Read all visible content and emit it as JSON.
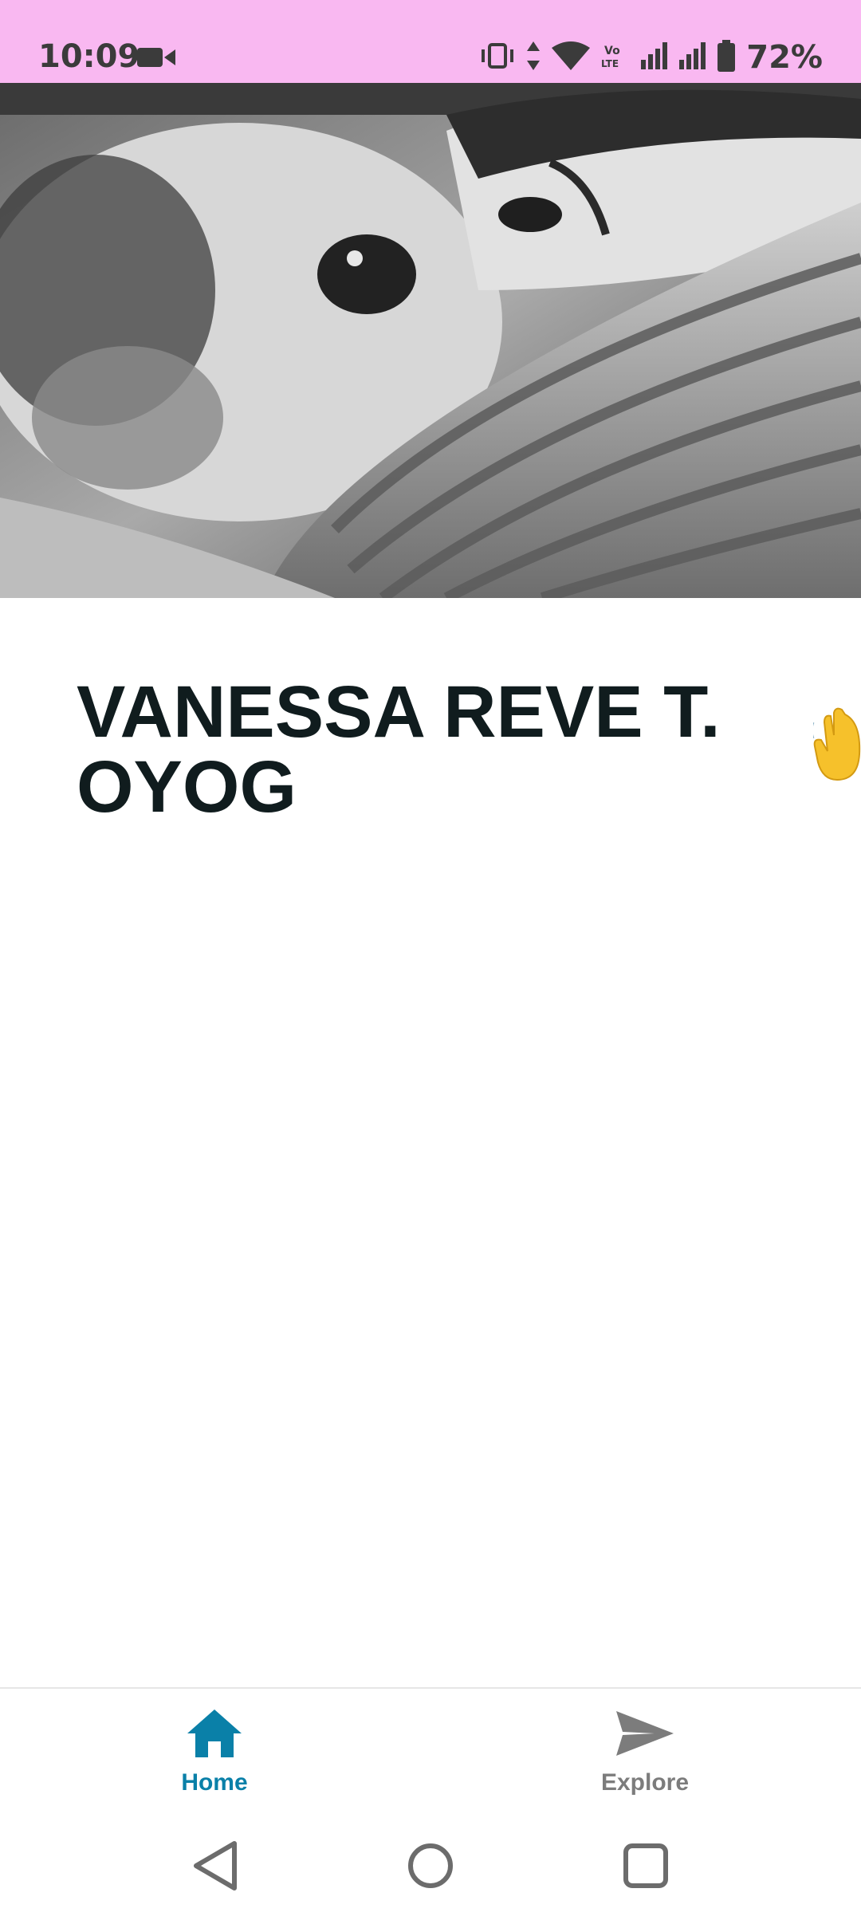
{
  "status_bar": {
    "time": "10:09",
    "battery": "72%",
    "left_icon": "video-camera-icon",
    "right_icons": [
      "vibrate-icon",
      "data-arrows-icon",
      "wifi-icon",
      "volte-icon",
      "signal-icon",
      "signal-icon",
      "battery-icon"
    ],
    "background_color": "#f9b8f1"
  },
  "hero": {
    "image_description_icon": "profile-photo"
  },
  "profile": {
    "name_line1": "VANESSA REVE T.",
    "name_line2": "OYOG",
    "emoji": "waving-hand-icon"
  },
  "bottom_nav": {
    "items": [
      {
        "label": "Home",
        "icon": "home-icon",
        "active": true,
        "color": "#0a80a8"
      },
      {
        "label": "Explore",
        "icon": "send-icon",
        "active": false,
        "color": "#7c7c7c"
      }
    ]
  },
  "system_nav": {
    "buttons": [
      "back-icon",
      "home-circle-icon",
      "recents-icon"
    ]
  }
}
